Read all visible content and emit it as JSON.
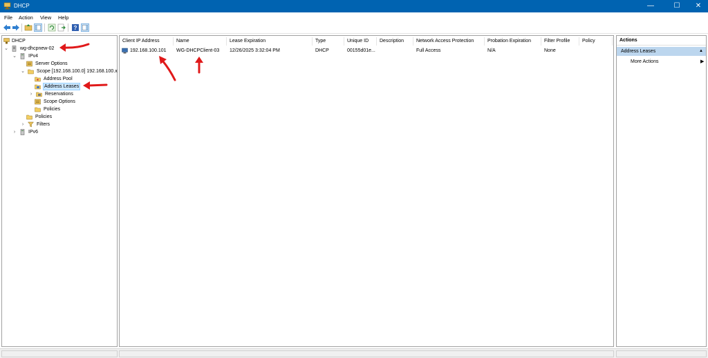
{
  "window": {
    "title": "DHCP",
    "controls": {
      "minimize": "—",
      "maximize": "☐",
      "close": "✕"
    }
  },
  "menu": [
    "File",
    "Action",
    "View",
    "Help"
  ],
  "toolbar_icons": [
    "back-arrow-icon",
    "forward-arrow-icon",
    "up-folder-icon",
    "show-hide-tree-icon",
    "refresh-icon",
    "export-list-icon",
    "help-icon",
    "show-hide-action-pane-icon"
  ],
  "tree": {
    "root": "DHCP",
    "server": "wg-dhcpnew-02",
    "ipv4": "IPv4",
    "server_options": "Server Options",
    "scope": "Scope [192.168.100.0] 192.168.100.x",
    "address_pool": "Address Pool",
    "address_leases": "Address Leases",
    "reservations": "Reservations",
    "scope_options": "Scope Options",
    "scope_policies": "Policies",
    "policies": "Policies",
    "filters": "Filters",
    "ipv6": "IPv6"
  },
  "list": {
    "columns": [
      "Client IP Address",
      "Name",
      "Lease Expiration",
      "Type",
      "Unique ID",
      "Description",
      "Network Access Protection",
      "Probation Expiration",
      "Filter Profile",
      "Policy"
    ],
    "rows": [
      {
        "ip": "192.168.100.101",
        "name": "WG-DHCPClient-03",
        "lease_expiration": "12/26/2025 3:32:04 PM",
        "type": "DHCP",
        "unique_id": "00155d01e...",
        "description": "",
        "nap": "Full Access",
        "probation": "N/A",
        "filter_profile": "None",
        "policy": ""
      }
    ]
  },
  "actions": {
    "header": "Actions",
    "section": "Address Leases",
    "items": [
      "More Actions"
    ]
  },
  "colors": {
    "titlebar": "#0063b1",
    "selection": "#cce8ff",
    "actions_section": "#bcd6ee",
    "annotation_arrow": "#e0191a"
  }
}
